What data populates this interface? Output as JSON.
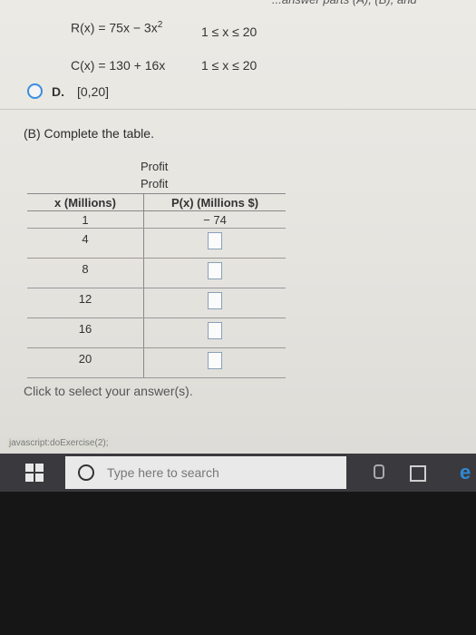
{
  "top_strip_text": "...answer parts (A), (B), and",
  "equations": {
    "revenue": {
      "lhs": "R(x) = 75x − 3x",
      "exp": "2",
      "domain": "1 ≤ x ≤ 20"
    },
    "cost": {
      "lhs": "C(x) = 130 + 16x",
      "domain": "1 ≤ x ≤ 20"
    }
  },
  "option_d": {
    "letter": "D.",
    "text": "[0,20]"
  },
  "part_b": {
    "question": "(B) Complete the table."
  },
  "table": {
    "header_profit_1": "Profit",
    "header_profit_2": "Profit",
    "col_x": "x (Millions)",
    "col_p": "P(x) (Millions $)",
    "rows": [
      {
        "x": "1",
        "p": "− 74"
      },
      {
        "x": "4",
        "p": ""
      },
      {
        "x": "8",
        "p": ""
      },
      {
        "x": "12",
        "p": ""
      },
      {
        "x": "16",
        "p": ""
      },
      {
        "x": "20",
        "p": ""
      }
    ]
  },
  "click_hint": "Click to select your answer(s).",
  "status_bar": "javascript:doExercise(2);",
  "taskbar": {
    "search_placeholder": "Type here to search"
  }
}
